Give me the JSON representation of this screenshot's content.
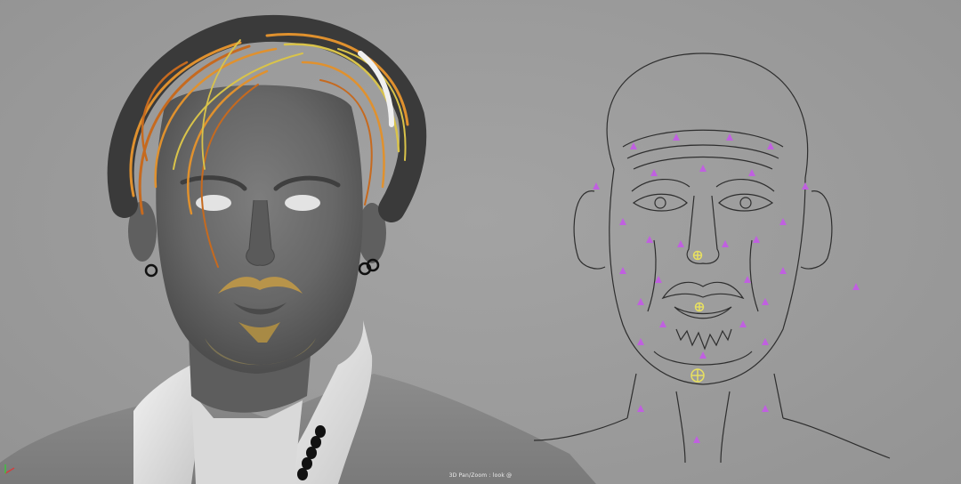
{
  "viewport": {
    "status_text": "3D Pan/Zoom : look @",
    "background": "#9b9b9b"
  },
  "left_model": {
    "description_name": "shaded-head-render",
    "skin_color": "#6e6e6e",
    "hair_colors": [
      "#e0912e",
      "#c66a1f",
      "#d9c34a",
      "#3a3a3a"
    ],
    "shirt_color": "#e2e2e2"
  },
  "right_rig": {
    "line_color": "#2e2e2e",
    "control_color": "#c060e0",
    "joint_color": "#e8e060"
  }
}
